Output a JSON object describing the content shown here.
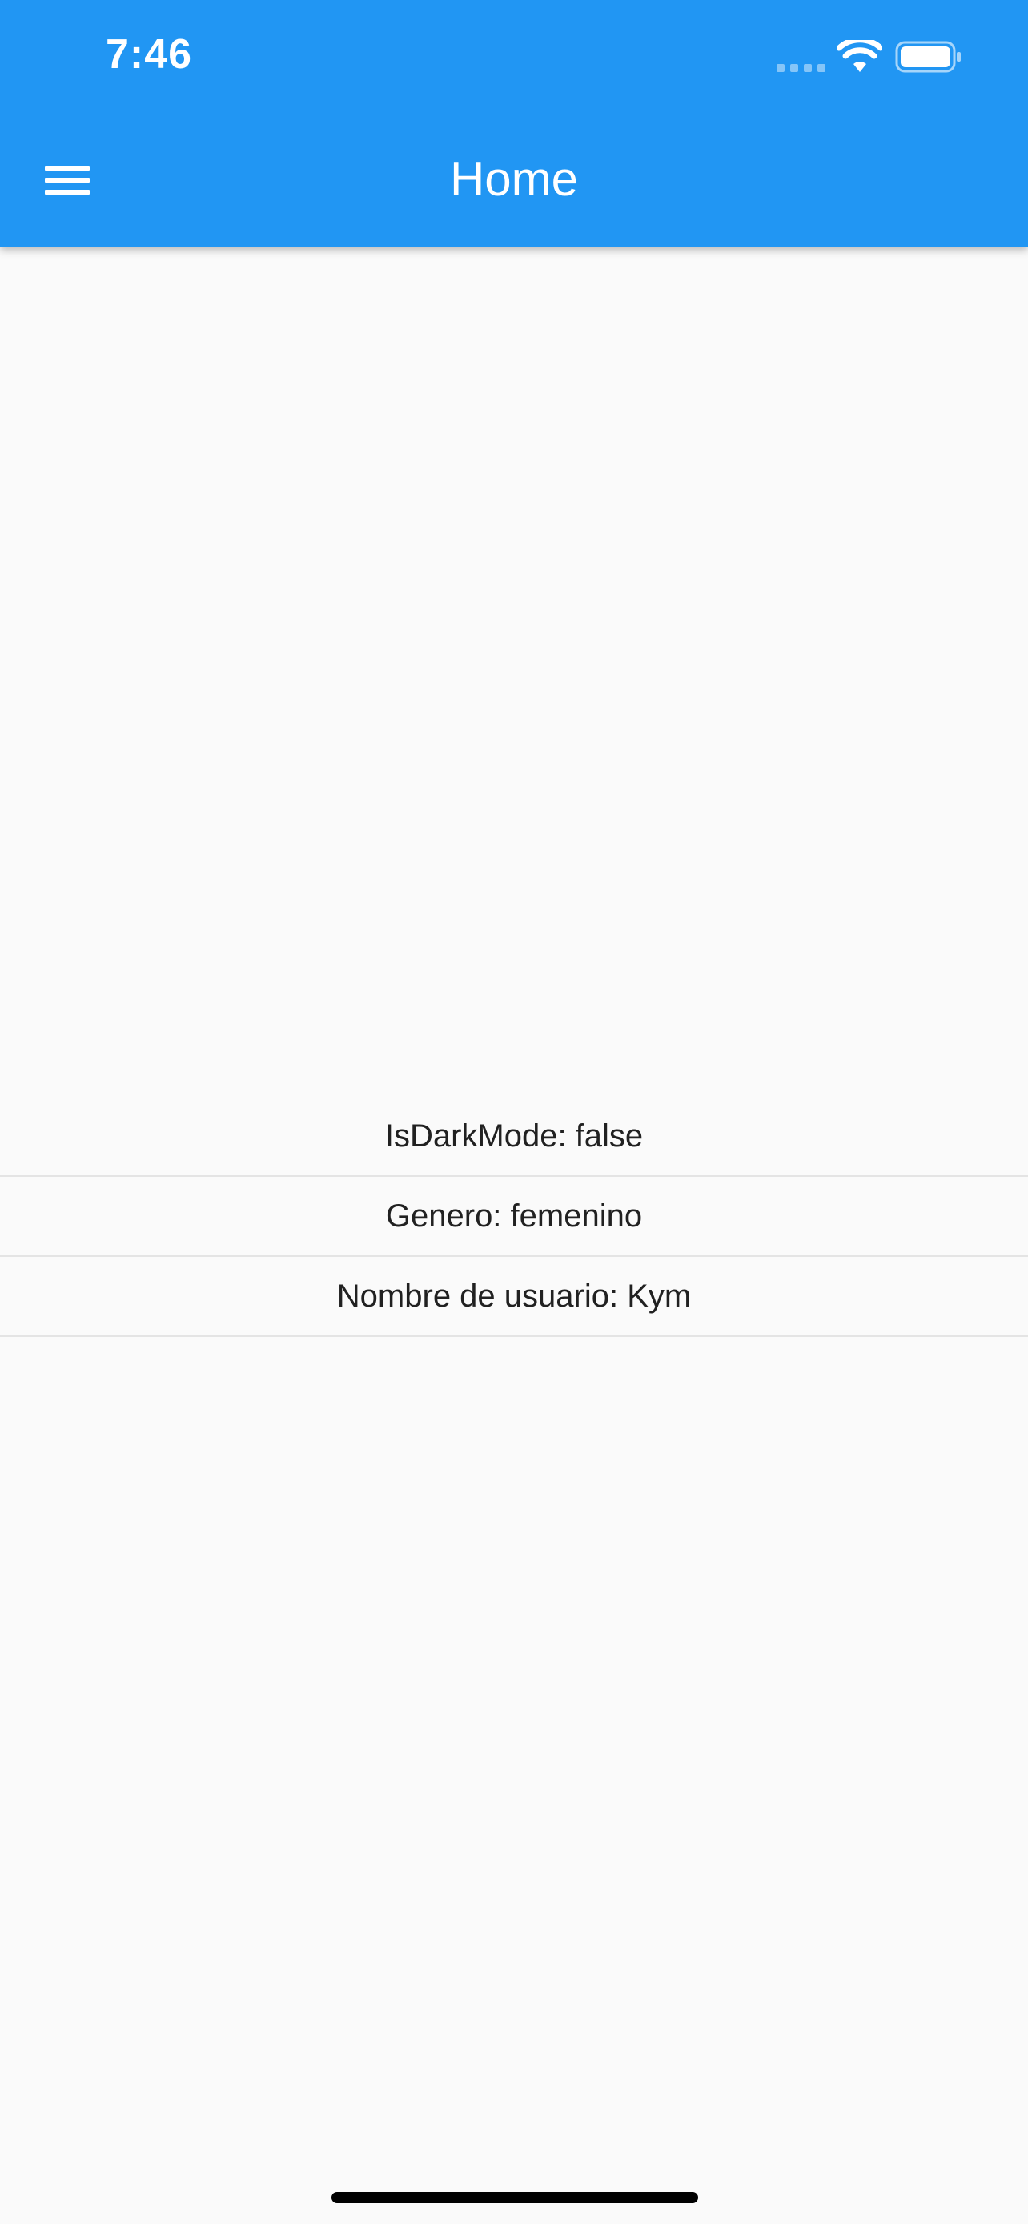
{
  "status_bar": {
    "time": "7:46"
  },
  "app_bar": {
    "title": "Home",
    "menu_icon": "hamburger-menu-icon",
    "background_color": "#2196f3"
  },
  "settings_list": [
    {
      "text": "IsDarkMode: false"
    },
    {
      "text": "Genero: femenino"
    },
    {
      "text": "Nombre de usuario: Kym"
    }
  ]
}
